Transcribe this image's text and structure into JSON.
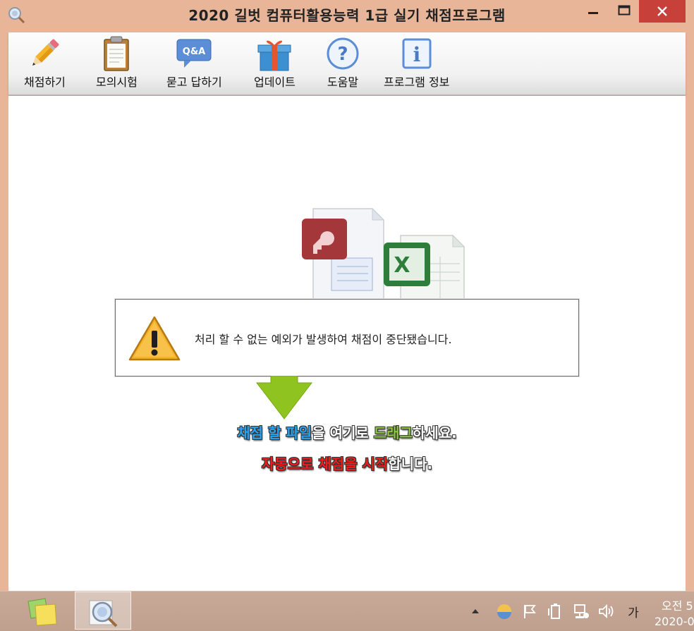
{
  "window": {
    "title": "2020 길벗 컴퓨터활용능력 1급 실기 채점프로그램"
  },
  "toolbar": {
    "items": [
      {
        "label": "채점하기",
        "icon": "pencil-icon"
      },
      {
        "label": "모의시험",
        "icon": "clipboard-icon"
      },
      {
        "label": "묻고 답하기",
        "icon": "qna-icon",
        "badge": "Q&A"
      },
      {
        "label": "업데이트",
        "icon": "gift-icon"
      },
      {
        "label": "도움말",
        "icon": "help-icon",
        "glyph": "?"
      },
      {
        "label": "프로그램 정보",
        "icon": "info-icon",
        "glyph": "i"
      }
    ]
  },
  "dialog": {
    "message": "처리 할 수 없는 예외가 발생하여 채점이 중단됐습니다."
  },
  "drop_zone": {
    "line1": [
      {
        "text": "채점 할 파일",
        "color": "blue"
      },
      {
        "text": "을 여기로 ",
        "color": "white"
      },
      {
        "text": "드래그",
        "color": "green"
      },
      {
        "text": "하세요.",
        "color": "white"
      }
    ],
    "line2": [
      {
        "text": "자동으로 채점을 시작",
        "color": "red"
      },
      {
        "text": "합니다.",
        "color": "white"
      }
    ]
  },
  "taskbar": {
    "ime_label": "가",
    "clock_time": "오전 5",
    "clock_date": "2020-0"
  },
  "colors": {
    "frame": "#e8b598",
    "close_button": "#c7403a",
    "accent_blue": "#2aa3ee",
    "accent_green": "#8dc63f",
    "accent_red": "#f01c1c"
  }
}
